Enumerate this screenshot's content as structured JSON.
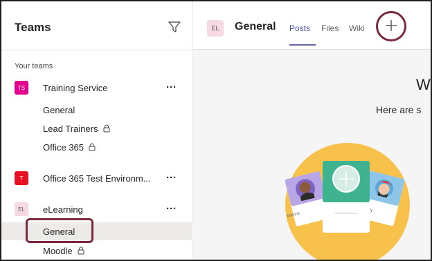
{
  "sidebar": {
    "title": "Teams",
    "section_label": "Your teams",
    "teams": [
      {
        "initials": "TS",
        "name": "Training Service",
        "color": "#e3008c",
        "channels": [
          {
            "name": "General",
            "locked": false
          },
          {
            "name": "Lead Trainers",
            "locked": true
          },
          {
            "name": "Office 365",
            "locked": true
          }
        ]
      },
      {
        "initials": "T",
        "name": "Office 365 Test Environm...",
        "color": "#e81123",
        "channels": []
      },
      {
        "initials": "EL",
        "name": "eLearning",
        "color": "#f6d9e3",
        "channels": [
          {
            "name": "General",
            "locked": false,
            "selected": true
          },
          {
            "name": "Moodle",
            "locked": true
          }
        ]
      }
    ],
    "more_glyph": "···"
  },
  "header": {
    "avatar_initials": "EL",
    "channel_title": "General",
    "tabs": [
      {
        "label": "Posts",
        "active": true
      },
      {
        "label": "Files",
        "active": false
      },
      {
        "label": "Wiki",
        "active": false
      }
    ],
    "add_tab_icon": "plus-icon"
  },
  "welcome": {
    "title": "W",
    "subtitle": "Here are s"
  },
  "illustration": {
    "card_left_name": "Maxine",
    "card_right_name": "ky"
  },
  "colors": {
    "accent": "#6264a7",
    "highlight_ring": "#7a2a3b",
    "illustration_circle": "#f8c14c",
    "card_teal": "#3fb28f"
  }
}
